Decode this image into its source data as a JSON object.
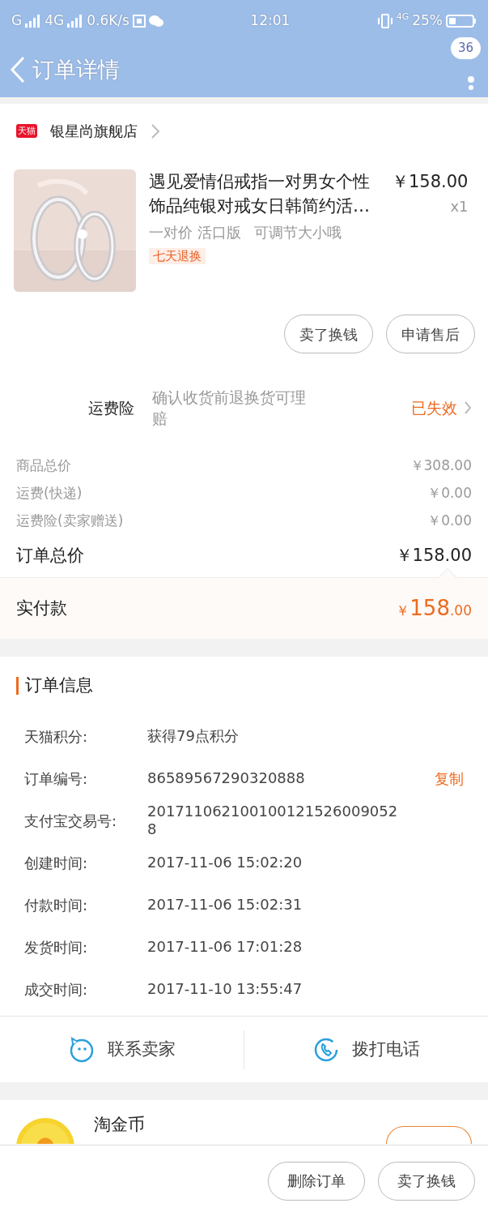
{
  "status_bar": {
    "carrier_1": "G",
    "carrier_2": "4G",
    "speed": "0.6K/s",
    "time": "12:01",
    "network": "4G",
    "battery": "25%"
  },
  "nav": {
    "title": "订单详情",
    "badge": "36"
  },
  "shop": {
    "platform": "天猫",
    "name": "银星尚旗舰店"
  },
  "product": {
    "title": "遇见爱情侣戒指一对男女个性饰品纯银对戒女日韩简约活…",
    "price": "￥158.00",
    "quantity": "x1",
    "spec": "一对价 活口版",
    "note": "可调节大小哦",
    "tag": "七天退换"
  },
  "product_actions": [
    "卖了换钱",
    "申请售后"
  ],
  "insurance": {
    "label": "运费险",
    "description": "确认收货前退换货可理赔",
    "status": "已失效"
  },
  "summary": [
    {
      "label": "商品总价",
      "value": "￥308.00",
      "kind": "minor"
    },
    {
      "label": "运费(快递)",
      "value": "￥0.00",
      "kind": "minor"
    },
    {
      "label": "运费险(卖家赠送)",
      "value": "￥0.00",
      "kind": "minor"
    },
    {
      "label": "订单总价",
      "value": "￥158.00",
      "kind": "total"
    }
  ],
  "paid": {
    "label": "实付款",
    "currency": "￥",
    "amount": "158",
    "decimals": ".00"
  },
  "order_info": {
    "title": "订单信息",
    "rows": [
      {
        "label": "天猫积分:",
        "value": "获得79点积分"
      },
      {
        "label": "订单编号:",
        "value": "86589567290320888",
        "action": "复制"
      },
      {
        "label": "支付宝交易号:",
        "value": "2017110621001001215260090528"
      },
      {
        "label": "创建时间:",
        "value": "2017-11-06 15:02:20"
      },
      {
        "label": "付款时间:",
        "value": "2017-11-06 15:02:31"
      },
      {
        "label": "发货时间:",
        "value": "2017-11-06 17:01:28"
      },
      {
        "label": "成交时间:",
        "value": "2017-11-10 13:55:47"
      }
    ]
  },
  "contact": [
    {
      "label": "联系卖家",
      "kind": "chat"
    },
    {
      "label": "拨打电话",
      "kind": "phone"
    }
  ],
  "coins": {
    "title": "淘金币"
  },
  "bottom_actions": [
    "删除订单",
    "卖了换钱"
  ]
}
